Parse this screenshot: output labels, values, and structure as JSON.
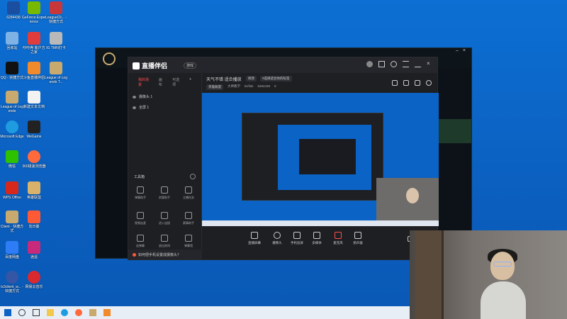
{
  "desktop": {
    "icons": [
      {
        "label": "6284438",
        "color": "#1a4ea0"
      },
      {
        "label": "GeForce Experience",
        "color": "#76b900"
      },
      {
        "label": "LeagueCli... - 快捷方式",
        "color": "#c8373a"
      },
      {
        "label": "回收站",
        "color": "#7fb2e5"
      },
      {
        "label": "吵吵壳 客户方之家",
        "color": "#e03c3c"
      },
      {
        "label": "IG TMN打卡",
        "color": "#b9b9b9"
      },
      {
        "label": "QQ - 快捷方式",
        "color": "#111111"
      },
      {
        "label": "斗鱼直播伴侣",
        "color": "#f08a2a"
      },
      {
        "label": "League of Legends T...",
        "color": "#c8aa6e"
      },
      {
        "label": "League of Legends",
        "color": "#c8aa6e"
      },
      {
        "label": "新建文本文档",
        "color": "#f2f2f2"
      },
      {
        "label": "Microsoft Edge",
        "color": "#1f9be0"
      },
      {
        "label": "WeGame",
        "color": "#222222"
      },
      {
        "label": "微信",
        "color": "#2dc100"
      },
      {
        "label": "360极速浏览器",
        "color": "#ff6a3d"
      },
      {
        "label": "WPS Office",
        "color": "#d7281c"
      },
      {
        "label": "英雄联盟",
        "color": "#d8b26b"
      },
      {
        "label": "Client - 快捷方式",
        "color": "#c8aa6e"
      },
      {
        "label": "向日葵",
        "color": "#ff5a36"
      },
      {
        "label": "百度网盘",
        "color": "#2f7df6"
      },
      {
        "label": "逍遥",
        "color": "#c72a7a"
      },
      {
        "label": "tx3client_w... - 快捷方式",
        "color": "#3456a5"
      },
      {
        "label": "网易云音乐",
        "color": "#d8292f"
      }
    ]
  },
  "app": {
    "brand": "直播伴侣",
    "badge": "游戏",
    "left_tabs": [
      "我的场景",
      "画布",
      "可选项"
    ],
    "sources": [
      "摄像头 1",
      "全屏 1"
    ],
    "tools_title": "工具箱",
    "tools": [
      "弹幕助手",
      "房管助手",
      "主播任务",
      "视频连麦",
      "进入连接",
      "赛事助手",
      "送弹幕",
      "退出房间",
      "弹幕墙",
      "画中画",
      "更多"
    ],
    "tip": "如何把手机设置成摄像头？",
    "room_title": "天气不错 适合播放",
    "room_chip": "修改",
    "room_chip2": "#选择适合你的标签",
    "room_meta": [
      "英雄联盟",
      "大神教学",
      "ID/link",
      "6284438",
      "0"
    ],
    "bottom_items": [
      "直播屏幕",
      "摄像头",
      "手机投屏",
      "多媒体",
      "麦克风",
      "扬声器"
    ]
  },
  "colors": {
    "desktop_bg": "#0b63c6",
    "accent": "#ff4d4f",
    "app_bg": "#1e1f23"
  }
}
